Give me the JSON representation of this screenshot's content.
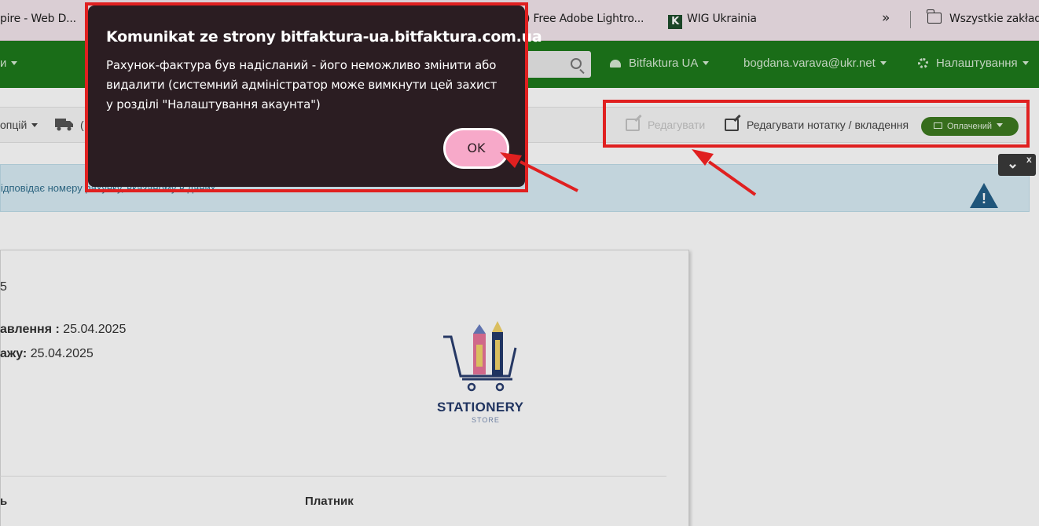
{
  "bookmarks": {
    "items": [
      {
        "label": "pire - Web D..."
      },
      {
        "label": ") Free Adobe Lightro..."
      },
      {
        "label": "WIG Ukrainia"
      }
    ],
    "overflow": "»",
    "folder_label": "Wszystkie zakładk",
    "k_letter": "K"
  },
  "navbar": {
    "left_label": "и",
    "company": "Bitfaktura UA",
    "user": "bogdana.varava@ukr.net",
    "settings": "Налаштування"
  },
  "toolbar": {
    "options": "опцій",
    "truck_suffix": "(",
    "edit": "Редагувати",
    "edit_note": "Редагувати нотатку / вкладення",
    "status": "Оплачений"
  },
  "alert": {
    "text": "ідповідає номеру рахунку, вказаному в даних ..."
  },
  "toggle": {
    "chevron": "⌄",
    "close": "x"
  },
  "document": {
    "number_fragment": "5",
    "issue_label": "авлення :",
    "issue_date": "25.04.2025",
    "sale_label": "ажу:",
    "sale_date": "25.04.2025",
    "seller_label": "ь",
    "payer_label": "Платник",
    "logo_title": "STATIONERY",
    "logo_sub": "STORE"
  },
  "dialog": {
    "title": "Komunikat ze strony bitfaktura-ua.bitfaktura.com.ua",
    "message": "Рахунок-фактура був надісланий - його неможливо змінити або видалити (системний адміністратор може вимкнути цей захист у розділі \"Налаштування акаунта\")",
    "ok": "OK"
  },
  "colors": {
    "navbar": "#1e7a1b",
    "dialog_bg": "#2b1d22",
    "ok_button": "#f7a9c9",
    "annotation": "#e02020",
    "status_button": "#3d7a20"
  }
}
